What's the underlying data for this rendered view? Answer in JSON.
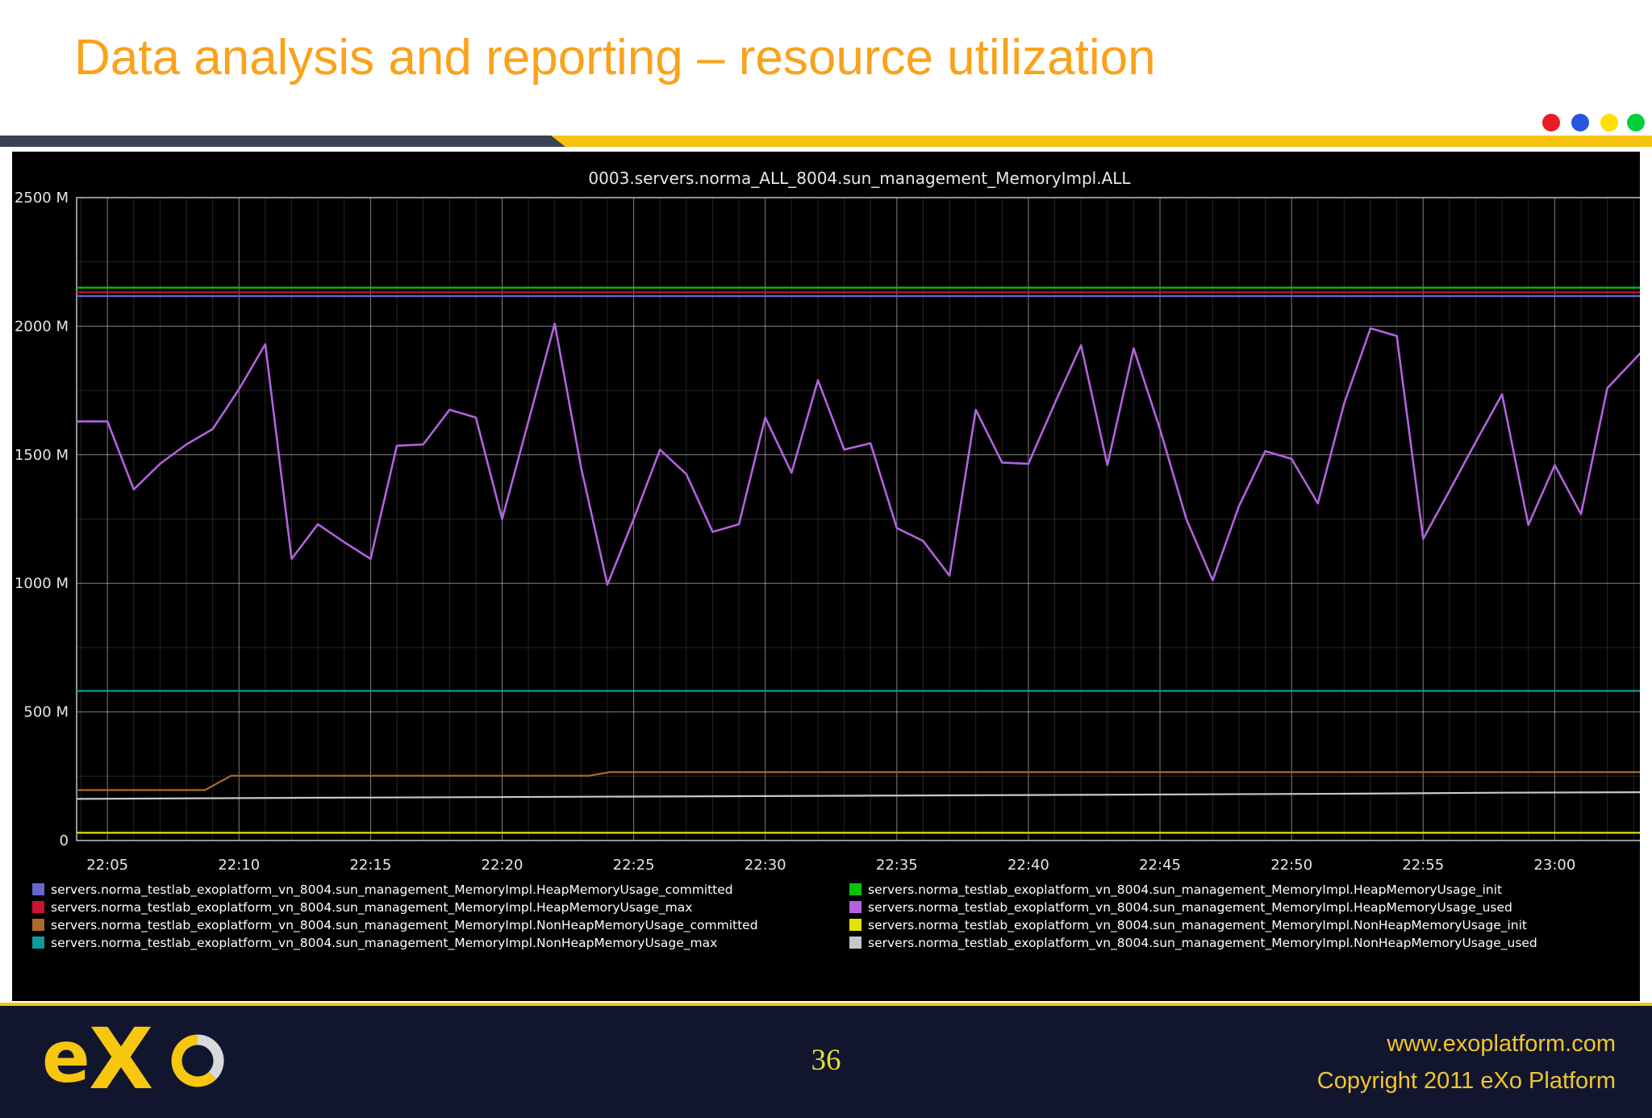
{
  "slide": {
    "title": "Data analysis and reporting – resource utilization",
    "title_color": "#F9A21C"
  },
  "header": {
    "dots": [
      "#EA1C23",
      "#2457DD",
      "#FFE000",
      "#00D03C"
    ],
    "bar_navy_color": "#3B4156",
    "bar_yellow_color": "#F6C313"
  },
  "chart_data": {
    "type": "line",
    "title": "0003.servers.norma_ALL_8004.sun_management_MemoryImpl.ALL",
    "background": "#000000",
    "grid": true,
    "legend_position": "bottom",
    "xlabel": "",
    "ylabel": "",
    "x_domain_minutes_after_2200": [
      3.83,
      63.33
    ],
    "x_minor_step_minutes": 1,
    "x_ticks": [
      {
        "m": 5,
        "label": "22:05"
      },
      {
        "m": 10,
        "label": "22:10"
      },
      {
        "m": 15,
        "label": "22:15"
      },
      {
        "m": 20,
        "label": "22:20"
      },
      {
        "m": 25,
        "label": "22:25"
      },
      {
        "m": 30,
        "label": "22:30"
      },
      {
        "m": 35,
        "label": "22:35"
      },
      {
        "m": 40,
        "label": "22:40"
      },
      {
        "m": 45,
        "label": "22:45"
      },
      {
        "m": 50,
        "label": "22:50"
      },
      {
        "m": 55,
        "label": "22:55"
      },
      {
        "m": 60,
        "label": "23:00"
      }
    ],
    "ylim": [
      0,
      2500
    ],
    "y_unit": "M (megabytes)",
    "y_major_step": 500,
    "y_minor_step": 250,
    "y_ticks": [
      {
        "v": 0,
        "label": "0"
      },
      {
        "v": 500,
        "label": "500 M"
      },
      {
        "v": 1000,
        "label": "1000 M"
      },
      {
        "v": 1500,
        "label": "1500 M"
      },
      {
        "v": 2000,
        "label": "2000 M"
      },
      {
        "v": 2500,
        "label": "2500 M"
      }
    ],
    "series": [
      {
        "name": "servers.norma_testlab_exoplatform_vn_8004.sun_management_MemoryImpl.HeapMemoryUsage_committed",
        "color": "#6666CF",
        "points": [
          [
            3.83,
            2117
          ],
          [
            63.33,
            2117
          ]
        ]
      },
      {
        "name": "servers.norma_testlab_exoplatform_vn_8004.sun_management_MemoryImpl.HeapMemoryUsage_max",
        "color": "#CC1133",
        "points": [
          [
            3.83,
            2132
          ],
          [
            63.33,
            2132
          ]
        ]
      },
      {
        "name": "servers.norma_testlab_exoplatform_vn_8004.sun_management_MemoryImpl.NonHeapMemoryUsage_committed",
        "color": "#AD6A2E",
        "points": [
          [
            3.83,
            196
          ],
          [
            8.7,
            196
          ],
          [
            9.7,
            252
          ],
          [
            23.3,
            252
          ],
          [
            24.1,
            266
          ],
          [
            63.33,
            266
          ]
        ]
      },
      {
        "name": "servers.norma_testlab_exoplatform_vn_8004.sun_management_MemoryImpl.NonHeapMemoryUsage_max",
        "color": "#0D9B9B",
        "points": [
          [
            3.83,
            582
          ],
          [
            63.33,
            582
          ]
        ]
      },
      {
        "name": "servers.norma_testlab_exoplatform_vn_8004.sun_management_MemoryImpl.HeapMemoryUsage_init",
        "color": "#0CC00C",
        "points": [
          [
            3.83,
            2150
          ],
          [
            63.33,
            2150
          ]
        ]
      },
      {
        "name": "servers.norma_testlab_exoplatform_vn_8004.sun_management_MemoryImpl.HeapMemoryUsage_used",
        "color": "#B263DE",
        "points": [
          [
            3.83,
            1630
          ],
          [
            5,
            1630
          ],
          [
            6,
            1365
          ],
          [
            7,
            1465
          ],
          [
            8,
            1540
          ],
          [
            9,
            1600
          ],
          [
            10,
            1755
          ],
          [
            11,
            1930
          ],
          [
            12,
            1095
          ],
          [
            13,
            1230
          ],
          [
            14,
            1160
          ],
          [
            15,
            1095
          ],
          [
            16,
            1535
          ],
          [
            17,
            1540
          ],
          [
            18,
            1675
          ],
          [
            19,
            1645
          ],
          [
            20,
            1250
          ],
          [
            21,
            1630
          ],
          [
            22,
            2010
          ],
          [
            23,
            1450
          ],
          [
            24,
            995
          ],
          [
            25,
            1250
          ],
          [
            26,
            1520
          ],
          [
            27,
            1425
          ],
          [
            28,
            1200
          ],
          [
            29,
            1230
          ],
          [
            30,
            1645
          ],
          [
            31,
            1430
          ],
          [
            32,
            1790
          ],
          [
            33,
            1520
          ],
          [
            34,
            1545
          ],
          [
            35,
            1215
          ],
          [
            36,
            1165
          ],
          [
            37,
            1030
          ],
          [
            38,
            1675
          ],
          [
            39,
            1470
          ],
          [
            40,
            1465
          ],
          [
            41,
            1700
          ],
          [
            42,
            1926
          ],
          [
            43,
            1460
          ],
          [
            44,
            1914
          ],
          [
            45,
            1600
          ],
          [
            46,
            1250
          ],
          [
            47,
            1012
          ],
          [
            48,
            1300
          ],
          [
            49,
            1514
          ],
          [
            50,
            1484
          ],
          [
            51,
            1311
          ],
          [
            52,
            1700
          ],
          [
            53,
            1992
          ],
          [
            54,
            1962
          ],
          [
            55,
            1173
          ],
          [
            56,
            1360
          ],
          [
            57,
            1550
          ],
          [
            58,
            1735
          ],
          [
            59,
            1227
          ],
          [
            60,
            1460
          ],
          [
            61,
            1269
          ],
          [
            62,
            1759
          ],
          [
            63.3,
            1900
          ]
        ]
      },
      {
        "name": "servers.norma_testlab_exoplatform_vn_8004.sun_management_MemoryImpl.NonHeapMemoryUsage_init",
        "color": "#E3E300",
        "points": [
          [
            3.83,
            30
          ],
          [
            63.33,
            30
          ]
        ]
      },
      {
        "name": "servers.norma_testlab_exoplatform_vn_8004.sun_management_MemoryImpl.NonHeapMemoryUsage_used",
        "color": "#C8C8C8",
        "points": [
          [
            3.83,
            162
          ],
          [
            12,
            166
          ],
          [
            25,
            171
          ],
          [
            40,
            177
          ],
          [
            52,
            182
          ],
          [
            58,
            186
          ],
          [
            63.33,
            188
          ]
        ]
      }
    ],
    "legend_note": "legend shows series 0-3 in left column, 4-7 in right column"
  },
  "footer": {
    "logo_text": "eXo",
    "page_number": "36",
    "url": "www.exoplatform.com",
    "copyright": "Copyright 2011 eXo Platform",
    "bg_color": "#12152E",
    "accent_color": "#F3C515",
    "text_color": "#EFC62F",
    "page_number_color": "#E4DF35",
    "logo_yellow": "#F7C70F",
    "logo_gray": "#D9D9D9"
  }
}
